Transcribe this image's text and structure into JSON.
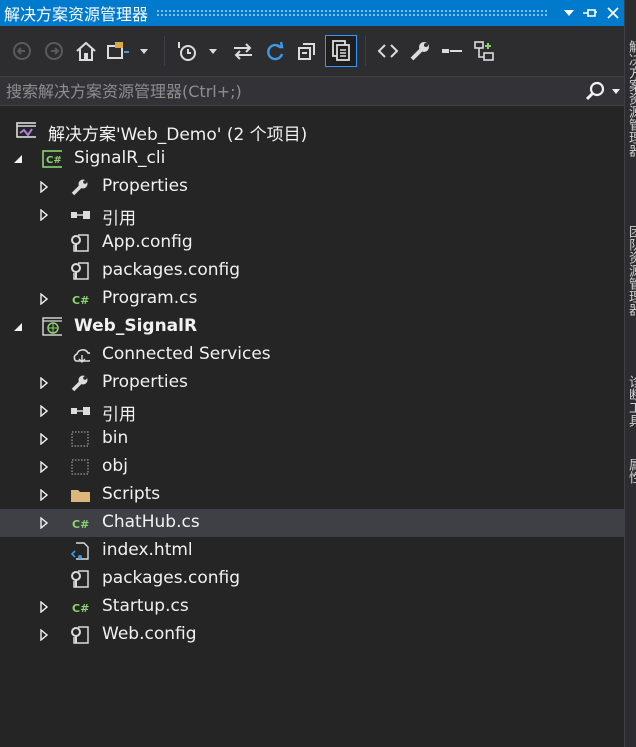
{
  "window": {
    "title": "解决方案资源管理器"
  },
  "search": {
    "placeholder": "搜索解决方案资源管理器(Ctrl+;)"
  },
  "side_tabs": [
    "解决方案资源管理器",
    "团队资源管理器",
    "诊断工具",
    "属性"
  ],
  "tree": {
    "solution": "解决方案'Web_Demo' (2 个项目)",
    "project1": {
      "name": "SignalR_cli",
      "items": [
        "Properties",
        "引用",
        "App.config",
        "packages.config",
        "Program.cs"
      ]
    },
    "project2": {
      "name": "Web_SignalR",
      "items": [
        "Connected Services",
        "Properties",
        "引用",
        "bin",
        "obj",
        "Scripts",
        "ChatHub.cs",
        "index.html",
        "packages.config",
        "Startup.cs",
        "Web.config"
      ]
    }
  },
  "icons": {
    "back": "arrow-left-icon",
    "forward": "arrow-right-icon",
    "home": "home-icon",
    "switch_views": "switch-views-icon",
    "pending_changes": "history-clock-icon",
    "sync": "sync-arrows-icon",
    "refresh": "refresh-icon",
    "collapse_all": "collapse-all-icon",
    "show_all_files": "show-all-files-icon",
    "view_code": "view-code-icon",
    "properties": "wrench-icon",
    "preview": "preview-icon",
    "class_view": "class-diagram-icon"
  },
  "colors": {
    "accent": "#007acc",
    "background": "#252526",
    "selection": "#3f3f46",
    "csharp": "#8bd36e"
  }
}
